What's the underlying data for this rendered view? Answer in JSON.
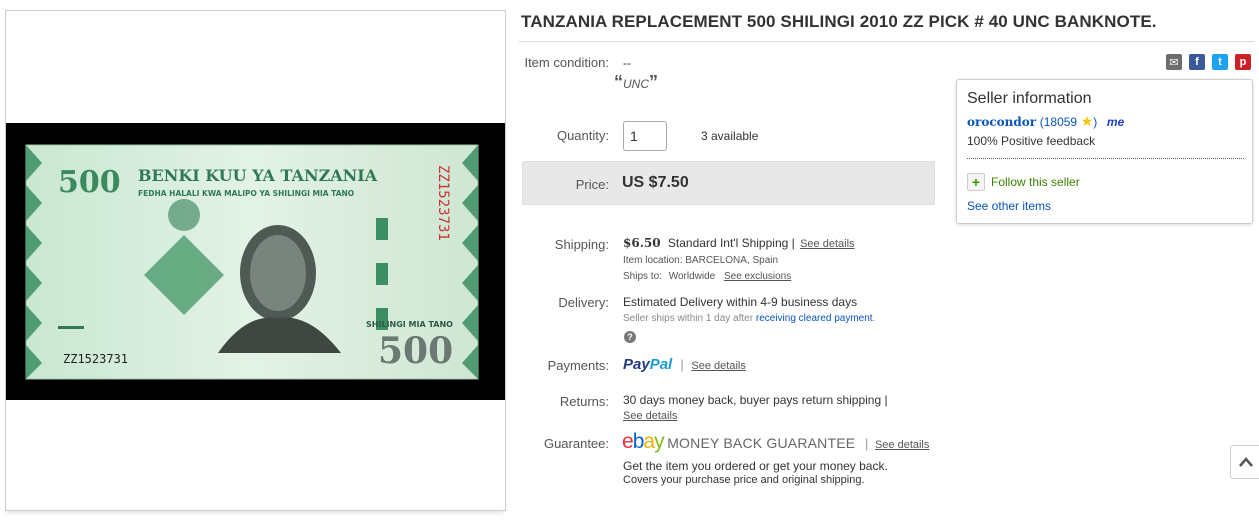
{
  "listing": {
    "title": "TANZANIA REPLACEMENT 500 SHILINGI 2010 ZZ PICK # 40 UNC BANKNOTE."
  },
  "banknote_image": {
    "bank_name": "BENKI KUU YA TANZANIA",
    "denomination": "500",
    "subtitle": "FEDHA HALALI KWA MALIPO YA SHILINGI MIA TANO",
    "amount_words": "SHILINGI MIA TANO",
    "serial_horizontal": "ZZ1523731",
    "serial_vertical": "ZZ1523731"
  },
  "condition": {
    "label": "Item condition:",
    "value": "--",
    "note": "UNC"
  },
  "quantity": {
    "label": "Quantity:",
    "value": "1",
    "available": "3 available"
  },
  "price": {
    "label": "Price:",
    "value": "US $7.50"
  },
  "shipping": {
    "label": "Shipping:",
    "cost": "$6.50",
    "method": "Standard Int'l Shipping |",
    "details_link": "See details",
    "location": "Item location:  BARCELONA, Spain",
    "ships_to_label": "Ships to:",
    "ships_to": "Worldwide",
    "exclusions_link": "See exclusions"
  },
  "delivery": {
    "label": "Delivery:",
    "estimate": "Estimated Delivery within 4-9 business days",
    "note_prefix": "Seller ships within 1 day after",
    "note_link": "receiving cleared payment",
    "note_suffix": "."
  },
  "payments": {
    "label": "Payments:",
    "paypal_pay": "Pay",
    "paypal_pal": "Pal",
    "details_link": "See details"
  },
  "returns": {
    "label": "Returns:",
    "text": "30 days money back, buyer pays return shipping |",
    "details_link": "See details"
  },
  "guarantee": {
    "label": "Guarantee:",
    "ebay_e": "e",
    "ebay_b": "b",
    "ebay_a": "a",
    "ebay_y": "y",
    "title": "MONEY BACK GUARANTEE",
    "details_link": "See details",
    "line1": "Get the item you ordered or get your money back.",
    "line2": "Covers your purchase price and original shipping."
  },
  "seller": {
    "heading": "Seller information",
    "username": "orocondor",
    "score": "(18059",
    "score_close": ")",
    "me_badge": "me",
    "feedback": "100% Positive feedback",
    "follow": "Follow this seller",
    "other_items": "See other items"
  },
  "colors": {
    "ebay_e": "#e53238",
    "ebay_b": "#0064d2",
    "ebay_a": "#f5af02",
    "ebay_y": "#86b817",
    "paypal_dark": "#253b80",
    "paypal_light": "#179bd7",
    "link": "#0654ba"
  },
  "icons": {
    "share": [
      "email-icon",
      "facebook-icon",
      "twitter-icon",
      "pinterest-icon"
    ],
    "star": "star-icon",
    "help": "question-icon",
    "scroll": "chevron-up-icon"
  }
}
